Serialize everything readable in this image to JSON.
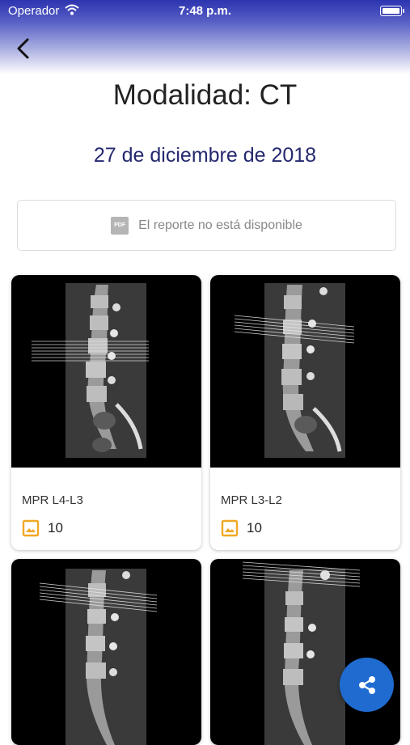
{
  "status_bar": {
    "carrier": "Operador",
    "time": "7:48 p.m."
  },
  "header": {
    "title": "Modalidad: CT",
    "date": "27 de diciembre de 2018"
  },
  "report": {
    "icon_text": "PDF",
    "message": "El reporte no está disponible"
  },
  "series": [
    {
      "label": "MPR L4-L3",
      "count": "10"
    },
    {
      "label": "MPR L3-L2",
      "count": "10"
    },
    {
      "label": "",
      "count": ""
    },
    {
      "label": "",
      "count": ""
    }
  ],
  "colors": {
    "header": "#2c34b0",
    "date_text": "#25296f",
    "fab": "#1f6bd0",
    "image_icon": "#f0a825"
  },
  "icons": {
    "back": "chevron-left-icon",
    "share": "share-icon",
    "images": "image-icon",
    "pdf": "pdf-icon"
  }
}
